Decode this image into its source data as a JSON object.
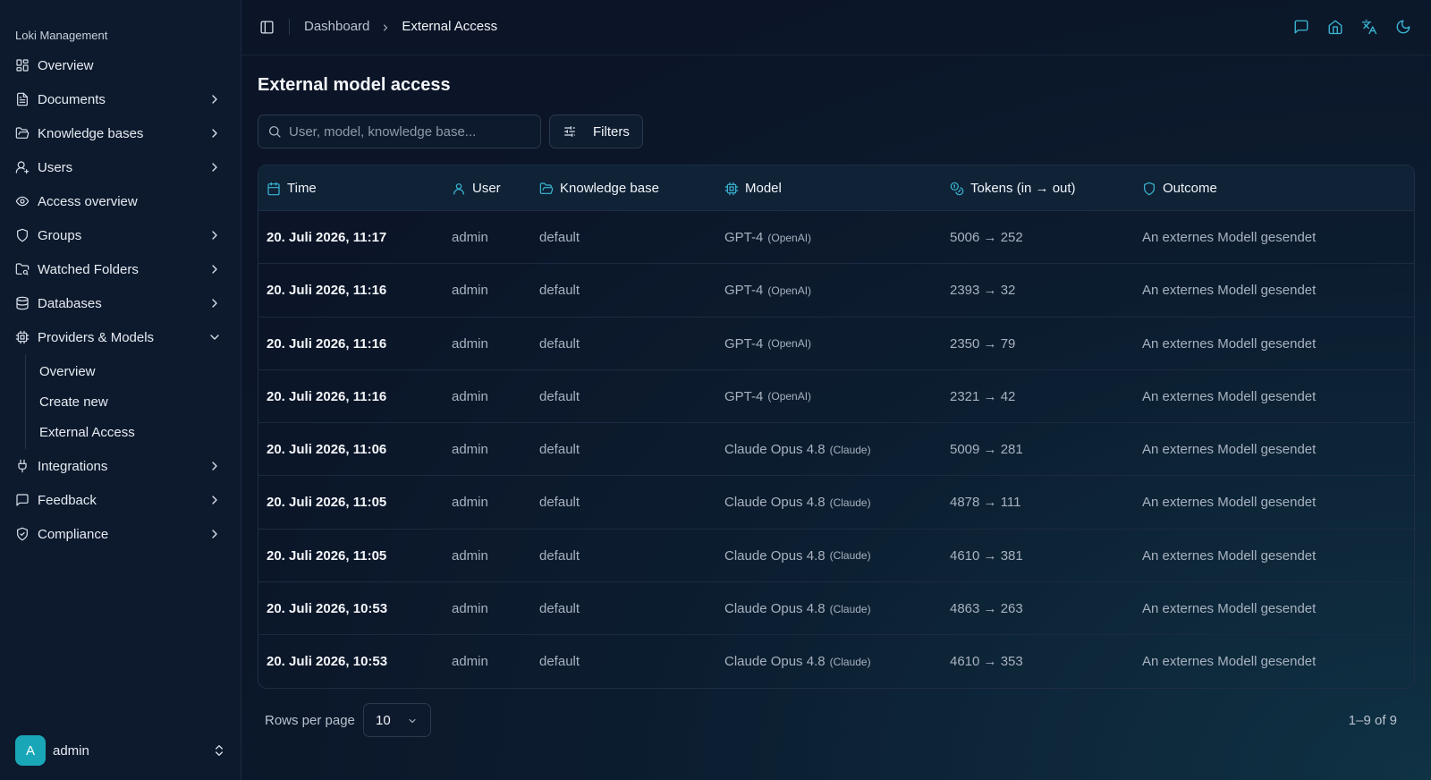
{
  "app": {
    "name": "Loki Management"
  },
  "sidebar": {
    "items": [
      {
        "label": "Overview",
        "icon": "layout-grid-icon",
        "chevron": false
      },
      {
        "label": "Documents",
        "icon": "document-icon",
        "chevron": true
      },
      {
        "label": "Knowledge bases",
        "icon": "folder-open-icon",
        "chevron": true
      },
      {
        "label": "Users",
        "icon": "user-plus-icon",
        "chevron": true
      },
      {
        "label": "Access overview",
        "icon": "eye-icon",
        "chevron": false
      },
      {
        "label": "Groups",
        "icon": "shield-icon",
        "chevron": true
      },
      {
        "label": "Watched Folders",
        "icon": "folder-search-icon",
        "chevron": true
      },
      {
        "label": "Databases",
        "icon": "database-icon",
        "chevron": true
      },
      {
        "label": "Providers & Models",
        "icon": "cpu-icon",
        "chevron": "open"
      },
      {
        "label": "Integrations",
        "icon": "plug-icon",
        "chevron": true
      },
      {
        "label": "Feedback",
        "icon": "message-square-icon",
        "chevron": true
      },
      {
        "label": "Compliance",
        "icon": "shield-check-icon",
        "chevron": true
      }
    ],
    "providers_sub": [
      "Overview",
      "Create new",
      "External Access"
    ],
    "user": {
      "initial": "A",
      "name": "admin"
    }
  },
  "topbar": {
    "breadcrumb": [
      "Dashboard",
      "External Access"
    ],
    "icons": [
      "message-icon",
      "home-icon",
      "translate-icon",
      "moon-icon"
    ]
  },
  "page": {
    "title": "External model access",
    "search_placeholder": "User, model, knowledge base...",
    "filters_label": "Filters"
  },
  "table": {
    "columns": [
      {
        "label": "Time",
        "icon": "calendar-icon"
      },
      {
        "label": "User",
        "icon": "user-icon"
      },
      {
        "label": "Knowledge base",
        "icon": "folder-icon"
      },
      {
        "label": "Model",
        "icon": "cpu-icon"
      },
      {
        "label": "Tokens (in → out)",
        "icon": "coins-icon"
      },
      {
        "label": "Outcome",
        "icon": "shield-icon"
      }
    ],
    "rows": [
      {
        "time": "20. Juli 2026, 11:17",
        "user": "admin",
        "kb": "default",
        "model": "GPT-4",
        "provider": "(OpenAI)",
        "tokens": "5006 → 252",
        "outcome": "An externes Modell gesendet"
      },
      {
        "time": "20. Juli 2026, 11:16",
        "user": "admin",
        "kb": "default",
        "model": "GPT-4",
        "provider": "(OpenAI)",
        "tokens": "2393 → 32",
        "outcome": "An externes Modell gesendet"
      },
      {
        "time": "20. Juli 2026, 11:16",
        "user": "admin",
        "kb": "default",
        "model": "GPT-4",
        "provider": "(OpenAI)",
        "tokens": "2350 → 79",
        "outcome": "An externes Modell gesendet"
      },
      {
        "time": "20. Juli 2026, 11:16",
        "user": "admin",
        "kb": "default",
        "model": "GPT-4",
        "provider": "(OpenAI)",
        "tokens": "2321 → 42",
        "outcome": "An externes Modell gesendet"
      },
      {
        "time": "20. Juli 2026, 11:06",
        "user": "admin",
        "kb": "default",
        "model": "Claude Opus 4.8",
        "provider": "(Claude)",
        "tokens": "5009 → 281",
        "outcome": "An externes Modell gesendet"
      },
      {
        "time": "20. Juli 2026, 11:05",
        "user": "admin",
        "kb": "default",
        "model": "Claude Opus 4.8",
        "provider": "(Claude)",
        "tokens": "4878 → 111",
        "outcome": "An externes Modell gesendet"
      },
      {
        "time": "20. Juli 2026, 11:05",
        "user": "admin",
        "kb": "default",
        "model": "Claude Opus 4.8",
        "provider": "(Claude)",
        "tokens": "4610 → 381",
        "outcome": "An externes Modell gesendet"
      },
      {
        "time": "20. Juli 2026, 10:53",
        "user": "admin",
        "kb": "default",
        "model": "Claude Opus 4.8",
        "provider": "(Claude)",
        "tokens": "4863 → 263",
        "outcome": "An externes Modell gesendet"
      },
      {
        "time": "20. Juli 2026, 10:53",
        "user": "admin",
        "kb": "default",
        "model": "Claude Opus 4.8",
        "provider": "(Claude)",
        "tokens": "4610 → 353",
        "outcome": "An externes Modell gesendet"
      }
    ]
  },
  "pagination": {
    "rows_per_page_label": "Rows per page",
    "rows_per_page": "10",
    "range": "1–9 of 9"
  },
  "colors": {
    "accent": "#3bb8d6",
    "avatar": "#19a7b8",
    "background": "#0b1527"
  }
}
